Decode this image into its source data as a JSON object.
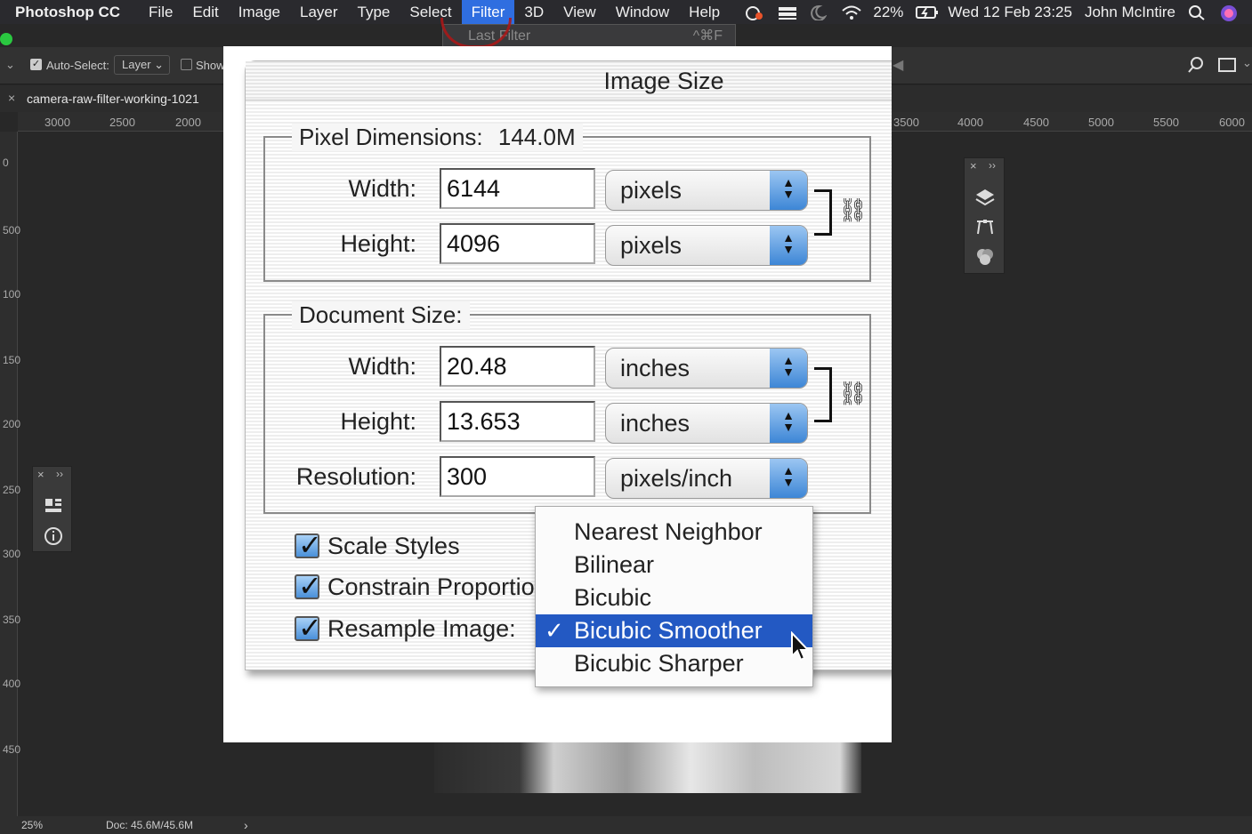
{
  "menubar": {
    "app": "Photoshop CC",
    "items": [
      "File",
      "Edit",
      "Image",
      "Layer",
      "Type",
      "Select",
      "Filter",
      "3D",
      "View",
      "Window",
      "Help"
    ],
    "active": "Filter",
    "battery": "22%",
    "datetime": "Wed 12 Feb 23:25",
    "user": "John McIntire"
  },
  "filter_menu": {
    "last_filter": "Last Filter",
    "shortcut": "^⌘F"
  },
  "options": {
    "auto_select_label": "Auto-Select:",
    "auto_select_value": "Layer",
    "show_label": "Show"
  },
  "document": {
    "tab": "camera-raw-filter-working-1021"
  },
  "ruler": {
    "h_left": [
      "3000",
      "2500",
      "2000"
    ],
    "h_right": [
      "3500",
      "4000",
      "4500",
      "5000",
      "5500",
      "6000"
    ],
    "v": [
      "0",
      "500",
      "100",
      "150",
      "200",
      "250",
      "300",
      "350",
      "400",
      "450"
    ]
  },
  "status": {
    "zoom": "25%",
    "doc": "Doc: 45.6M/45.6M"
  },
  "dialog": {
    "title": "Image Size",
    "pixel_dimensions": {
      "legend": "Pixel Dimensions:",
      "size": "144.0M",
      "width_label": "Width:",
      "width_value": "6144",
      "width_unit": "pixels",
      "height_label": "Height:",
      "height_value": "4096",
      "height_unit": "pixels"
    },
    "document_size": {
      "legend": "Document Size:",
      "width_label": "Width:",
      "width_value": "20.48",
      "width_unit": "inches",
      "height_label": "Height:",
      "height_value": "13.653",
      "height_unit": "inches",
      "resolution_label": "Resolution:",
      "resolution_value": "300",
      "resolution_unit": "pixels/inch"
    },
    "checkboxes": {
      "scale_styles": "Scale Styles",
      "constrain": "Constrain Proportions",
      "resample": "Resample Image:"
    },
    "resample_options": [
      "Nearest Neighbor",
      "Bilinear",
      "Bicubic",
      "Bicubic Smoother",
      "Bicubic Sharper"
    ],
    "resample_selected": "Bicubic Smoother"
  }
}
